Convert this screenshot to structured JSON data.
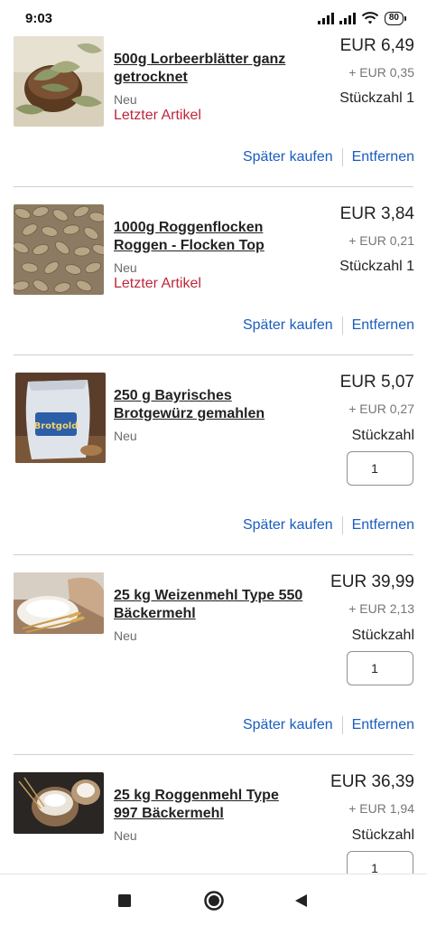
{
  "status_bar": {
    "time": "9:03",
    "battery": "80"
  },
  "items": [
    {
      "title": "500g Lorbeerblätter ganz getrocknet",
      "condition": "Neu",
      "stock_note": "Letzter Artikel",
      "price": "EUR 6,49",
      "shipping": "+ EUR 0,35",
      "quantity_text": "Stückzahl 1",
      "actions": {
        "later": "Später kaufen",
        "remove": "Entfernen"
      },
      "image": "bay-leaves-photo"
    },
    {
      "title": "1000g Roggenflocken Roggen - Flocken Top",
      "condition": "Neu",
      "stock_note": "Letzter Artikel",
      "price": "EUR 3,84",
      "shipping": "+ EUR 0,21",
      "quantity_text": "Stückzahl 1",
      "actions": {
        "later": "Später kaufen",
        "remove": "Entfernen"
      },
      "image": "rye-flakes-photo"
    },
    {
      "title": "250 g Bayrisches Brotgewürz gemahlen",
      "condition": "Neu",
      "price": "EUR 5,07",
      "shipping": "+ EUR 0,27",
      "quantity_label": "Stückzahl",
      "quantity_value": "1",
      "actions": {
        "later": "Später kaufen",
        "remove": "Entfernen"
      },
      "image": "bread-spice-bag-photo",
      "image_text": "Brotgold"
    },
    {
      "title": "25 kg Weizenmehl Type 550 Bäckermehl",
      "condition": "Neu",
      "price": "EUR 39,99",
      "shipping": "+ EUR 2,13",
      "quantity_label": "Stückzahl",
      "quantity_value": "1",
      "actions": {
        "later": "Später kaufen",
        "remove": "Entfernen"
      },
      "image": "wheat-flour-photo"
    },
    {
      "title": "25 kg Roggenmehl Type 997 Bäckermehl",
      "condition": "Neu",
      "price": "EUR 36,39",
      "shipping": "+ EUR 1,94",
      "quantity_label": "Stückzahl",
      "quantity_value": "1",
      "image": "rye-flour-photo"
    }
  ],
  "colors": {
    "link": "#1a5cbe",
    "alert": "#c0263b",
    "divider": "#cfcfcf"
  },
  "nav": {
    "recents_icon": "square-icon",
    "home_icon": "circle-icon",
    "back_icon": "triangle-back-icon"
  }
}
